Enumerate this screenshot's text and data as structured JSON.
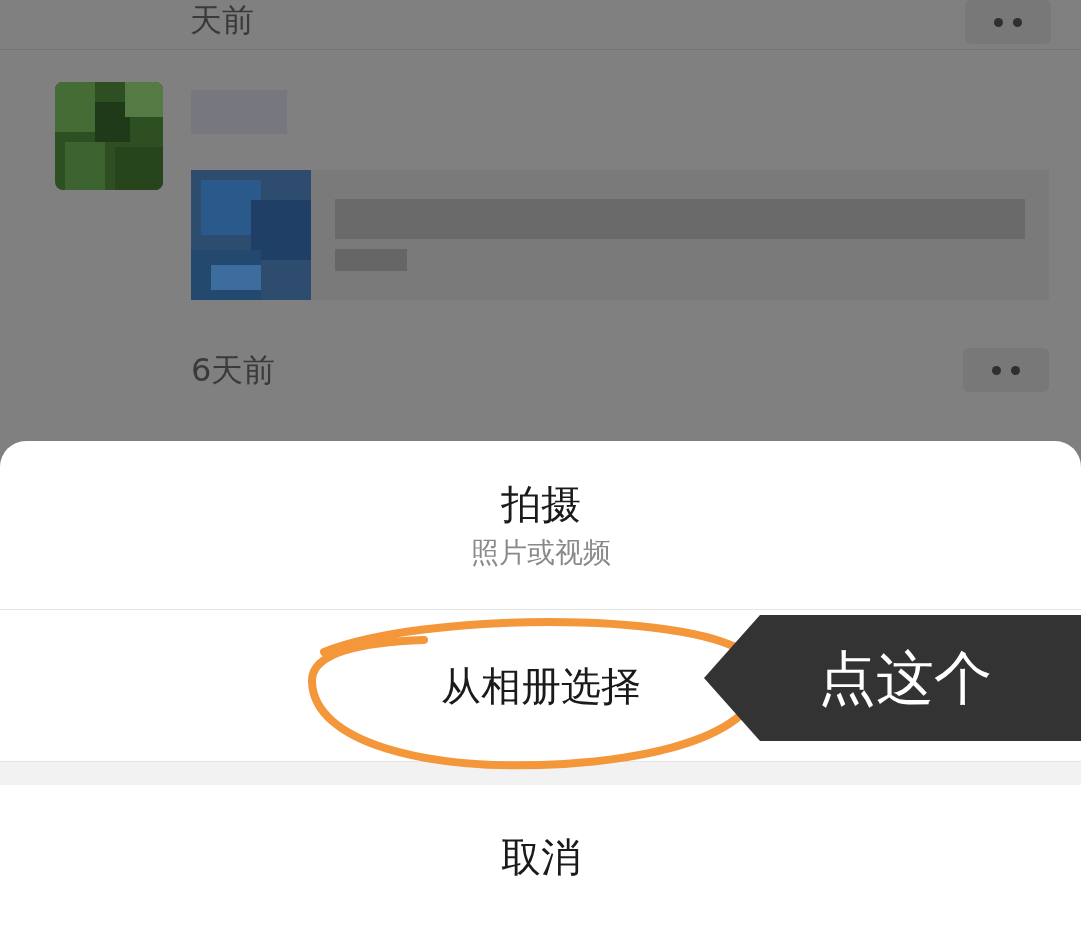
{
  "feed": {
    "posts": [
      {
        "time": "天前",
        "kind": "time-only"
      },
      {
        "time": "6天前",
        "kind": "link-post"
      }
    ]
  },
  "action_sheet": {
    "options": [
      {
        "title": "拍摄",
        "subtitle": "照片或视频"
      },
      {
        "title": "从相册选择"
      }
    ],
    "cancel": "取消"
  },
  "annotation": {
    "callout": "点这个"
  }
}
